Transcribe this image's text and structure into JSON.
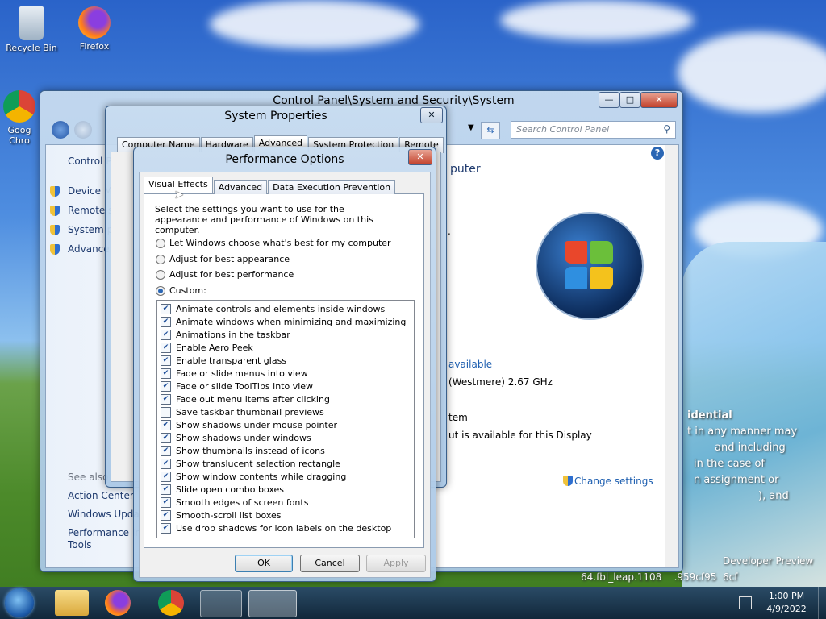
{
  "desktop": {
    "icons": [
      {
        "label": "Recycle Bin"
      },
      {
        "label": "Firefox"
      },
      {
        "label": "Goog\nChro"
      }
    ],
    "wallpaper_text": {
      "line1": "idential",
      "line2": "t in any manner may",
      "line3": "and including",
      "line4": "in the case of",
      "line5": "n assignment or",
      "line6": "), and",
      "line7": "Developer Preview",
      "line8": "64.fbl_leap.1108",
      "line9": ".959cf95",
      "line10": "6cf"
    }
  },
  "control_panel": {
    "title": "Control Panel\\System and Security\\System",
    "search_placeholder": "Search Control Panel",
    "sidebar": {
      "home": "Control P",
      "items": [
        "Device M",
        "Remote s",
        "System p",
        "Advance"
      ],
      "see_also": "See also",
      "links": [
        "Action Center",
        "Windows Upda",
        "Performance In",
        "Tools"
      ]
    },
    "main": {
      "heading": "puter",
      "line_dot": ".",
      "available": "available",
      "processor": "(Westmere)   2.67 GHz",
      "system_type": "tem",
      "pen_touch": "ut is available for this Display",
      "change_settings": "Change settings",
      "help": "?"
    },
    "caption": {
      "min": "—",
      "max": "□",
      "close": "✕"
    }
  },
  "system_properties": {
    "title": "System Properties",
    "close": "✕",
    "tabs": [
      "Computer Name",
      "Hardware",
      "Advanced",
      "System Protection",
      "Remote"
    ]
  },
  "performance_options": {
    "title": "Performance Options",
    "close": "✕",
    "tabs": [
      "Visual Effects",
      "Advanced",
      "Data Execution Prevention"
    ],
    "description": "Select the settings you want to use for the appearance and performance of Windows on this computer.",
    "radios": [
      {
        "label": "Let Windows choose what's best for my computer",
        "checked": false
      },
      {
        "label": "Adjust for best appearance",
        "checked": false
      },
      {
        "label": "Adjust for best performance",
        "checked": false
      },
      {
        "label": "Custom:",
        "checked": true
      }
    ],
    "effects": [
      {
        "label": "Animate controls and elements inside windows",
        "checked": true
      },
      {
        "label": "Animate windows when minimizing and maximizing",
        "checked": true
      },
      {
        "label": "Animations in the taskbar",
        "checked": true
      },
      {
        "label": "Enable Aero Peek",
        "checked": true
      },
      {
        "label": "Enable transparent glass",
        "checked": true
      },
      {
        "label": "Fade or slide menus into view",
        "checked": true
      },
      {
        "label": "Fade or slide ToolTips into view",
        "checked": true
      },
      {
        "label": "Fade out menu items after clicking",
        "checked": true
      },
      {
        "label": "Save taskbar thumbnail previews",
        "checked": false
      },
      {
        "label": "Show shadows under mouse pointer",
        "checked": true
      },
      {
        "label": "Show shadows under windows",
        "checked": true
      },
      {
        "label": "Show thumbnails instead of icons",
        "checked": true
      },
      {
        "label": "Show translucent selection rectangle",
        "checked": true
      },
      {
        "label": "Show window contents while dragging",
        "checked": true
      },
      {
        "label": "Slide open combo boxes",
        "checked": true
      },
      {
        "label": "Smooth edges of screen fonts",
        "checked": true
      },
      {
        "label": "Smooth-scroll list boxes",
        "checked": true
      },
      {
        "label": "Use drop shadows for icon labels on the desktop",
        "checked": true
      }
    ],
    "buttons": {
      "ok": "OK",
      "cancel": "Cancel",
      "apply": "Apply"
    }
  },
  "taskbar": {
    "time": "1:00 PM",
    "date": "4/9/2022"
  },
  "colors": {
    "link": "#1e3a6e",
    "accent": "#2a66b4",
    "close_red": "#c2412b"
  }
}
